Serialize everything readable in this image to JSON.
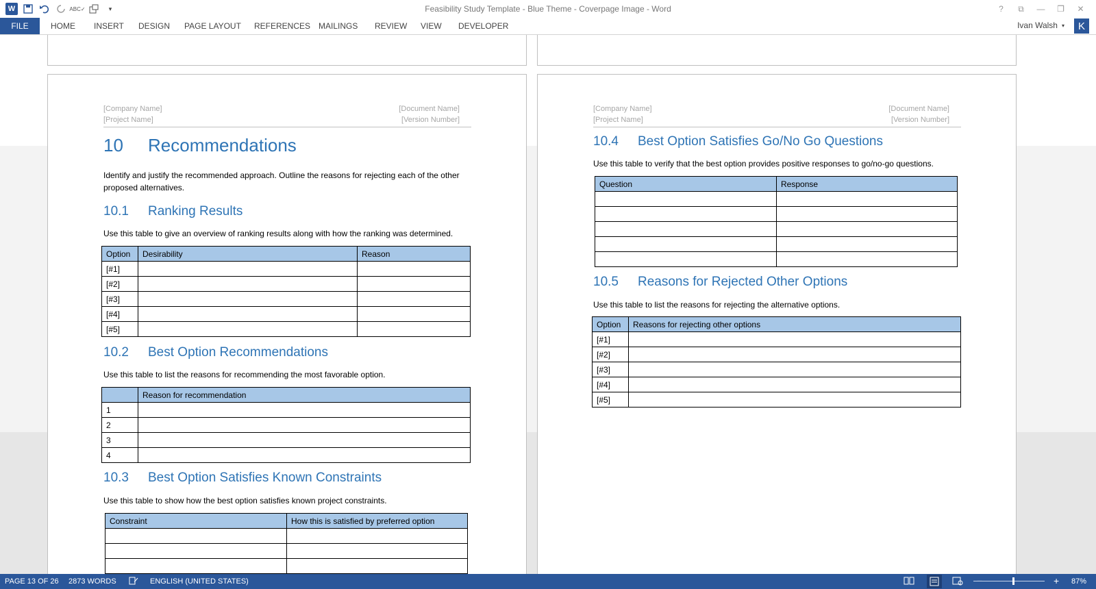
{
  "window": {
    "title": "Feasibility Study Template - Blue Theme - Coverpage Image - Word",
    "user": "Ivan Walsh",
    "avatar_letter": "K"
  },
  "ribbon": {
    "tabs": [
      "FILE",
      "HOME",
      "INSERT",
      "DESIGN",
      "PAGE LAYOUT",
      "REFERENCES",
      "MAILINGS",
      "REVIEW",
      "VIEW",
      "DEVELOPER"
    ]
  },
  "left_page": {
    "header": {
      "company": "[Company Name]",
      "project": "[Project Name]",
      "document": "[Document Name]",
      "version": "[Version Number]"
    },
    "h1_num": "10",
    "h1_text": "Recommendations",
    "intro": "Identify and justify the recommended approach. Outline the reasons for rejecting each of the other proposed alternatives.",
    "s1": {
      "num": "10.1",
      "title": "Ranking Results",
      "text": "Use this table to give an overview of ranking results along with how the ranking was determined.",
      "headers": [
        "Option",
        "Desirability",
        "Reason"
      ],
      "rows": [
        "[#1]",
        "[#2]",
        "[#3]",
        "[#4]",
        "[#5]"
      ]
    },
    "s2": {
      "num": "10.2",
      "title": "Best Option Recommendations",
      "text": "Use this table to list the reasons for recommending the most favorable option.",
      "headers": [
        "",
        "Reason for recommendation"
      ],
      "rows": [
        "1",
        "2",
        "3",
        "4"
      ]
    },
    "s3": {
      "num": "10.3",
      "title": "Best Option Satisfies Known Constraints",
      "text": "Use this table to show how the best option satisfies known project constraints.",
      "headers": [
        "Constraint",
        "How this is satisfied by preferred option"
      ]
    }
  },
  "right_page": {
    "header": {
      "company": "[Company Name]",
      "project": "[Project Name]",
      "document": "[Document Name]",
      "version": "[Version Number]"
    },
    "s4": {
      "num": "10.4",
      "title": "Best Option Satisfies Go/No Go Questions",
      "text": "Use this table to verify that the best option provides positive responses to go/no-go questions.",
      "headers": [
        "Question",
        "Response"
      ]
    },
    "s5": {
      "num": "10.5",
      "title": "Reasons for Rejected Other Options",
      "text": "Use this table to list the reasons for rejecting the alternative options.",
      "headers": [
        "Option",
        "Reasons for rejecting other options"
      ],
      "rows": [
        "[#1]",
        "[#2]",
        "[#3]",
        "[#4]",
        "[#5]"
      ]
    }
  },
  "status": {
    "page": "PAGE 13 OF 26",
    "words": "2873 WORDS",
    "language": "ENGLISH (UNITED STATES)",
    "zoom": "87%",
    "zoom_minus": "−",
    "zoom_plus": "+"
  },
  "colors": {
    "accent": "#2b579a",
    "heading": "#2e74b5",
    "table_header": "#a7c7e7"
  }
}
